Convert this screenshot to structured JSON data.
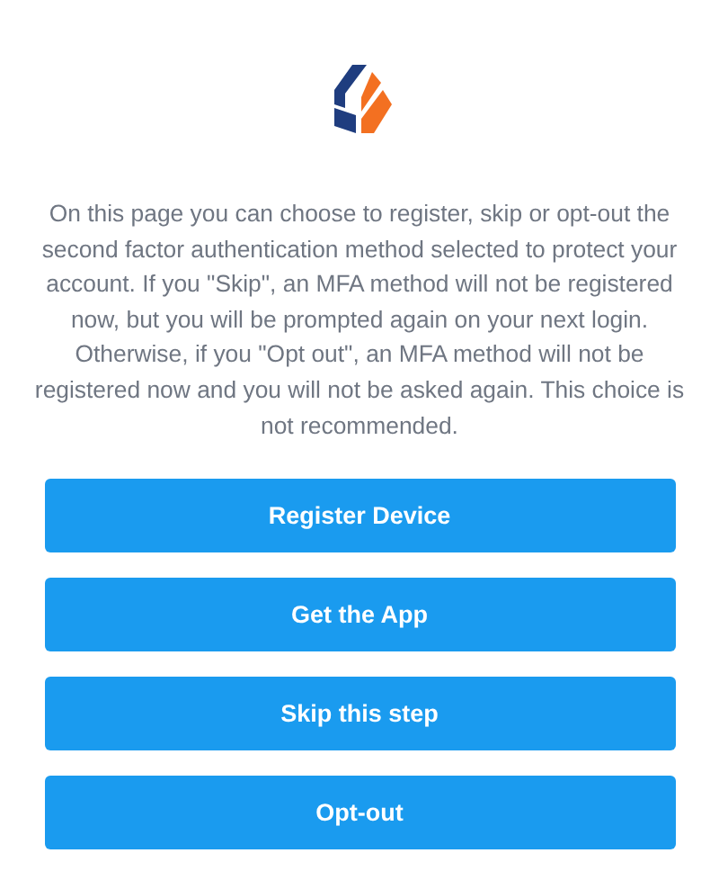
{
  "message": "On this page you can choose to register, skip or opt-out the second factor authentication method selected to protect your account. If you \"Skip\", an MFA method will not be registered now, but you will be prompted again on your next login. Otherwise, if you \"Opt out\", an MFA method will not be registered now and you will not be asked again. This choice is not recommended.",
  "buttons": [
    {
      "label": "Register Device"
    },
    {
      "label": "Get the App"
    },
    {
      "label": "Skip this step"
    },
    {
      "label": "Opt-out"
    }
  ]
}
